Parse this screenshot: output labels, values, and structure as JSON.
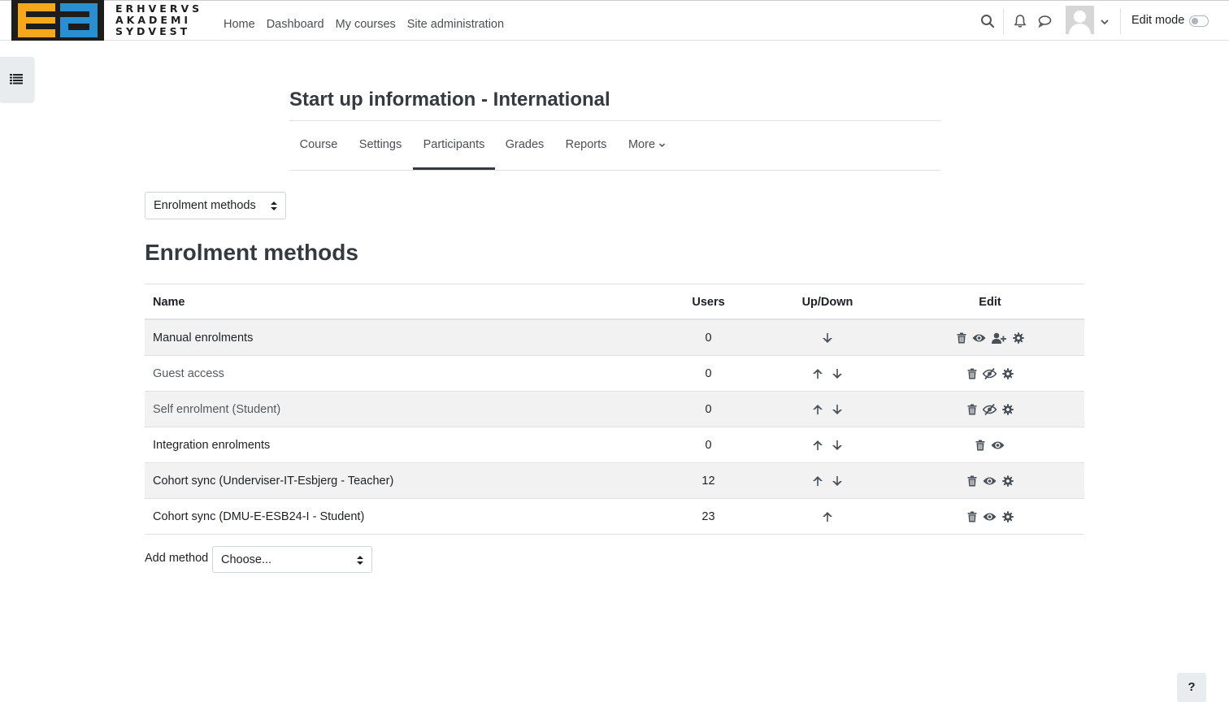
{
  "brand": {
    "logo_lines": [
      "ERHVERVS",
      "AKADEMI",
      "SYDVEST"
    ]
  },
  "nav": {
    "links": [
      "Home",
      "Dashboard",
      "My courses",
      "Site administration"
    ],
    "edit_mode_label": "Edit mode"
  },
  "course": {
    "title": "Start up information - International",
    "tabs": [
      "Course",
      "Settings",
      "Participants",
      "Grades",
      "Reports",
      "More"
    ],
    "active_tab": "Participants"
  },
  "page_select": {
    "value": "Enrolment methods"
  },
  "section": {
    "title": "Enrolment methods"
  },
  "table": {
    "headers": {
      "name": "Name",
      "users": "Users",
      "updown": "Up/Down",
      "edit": "Edit"
    },
    "rows": [
      {
        "name": "Manual enrolments",
        "users": "0",
        "updown": [
          "down"
        ],
        "edit": [
          "delete",
          "show",
          "enrol-users",
          "settings"
        ],
        "dim": false
      },
      {
        "name": "Guest access",
        "users": "0",
        "updown": [
          "up",
          "down"
        ],
        "edit": [
          "delete",
          "hidden",
          "settings"
        ],
        "dim": true
      },
      {
        "name": "Self enrolment (Student)",
        "users": "0",
        "updown": [
          "up",
          "down"
        ],
        "edit": [
          "delete",
          "hidden",
          "settings"
        ],
        "dim": true
      },
      {
        "name": "Integration enrolments",
        "users": "0",
        "updown": [
          "up",
          "down"
        ],
        "edit": [
          "delete",
          "show"
        ],
        "dim": false
      },
      {
        "name": "Cohort sync (Underviser-IT-Esbjerg - Teacher)",
        "users": "12",
        "updown": [
          "up",
          "down"
        ],
        "edit": [
          "delete",
          "show",
          "settings"
        ],
        "dim": false
      },
      {
        "name": "Cohort sync (DMU-E-ESB24-I - Student)",
        "users": "23",
        "updown": [
          "up"
        ],
        "edit": [
          "delete",
          "show",
          "settings"
        ],
        "dim": false
      }
    ]
  },
  "add_method": {
    "label": "Add method",
    "value": "Choose..."
  },
  "help": {
    "label": "?"
  }
}
